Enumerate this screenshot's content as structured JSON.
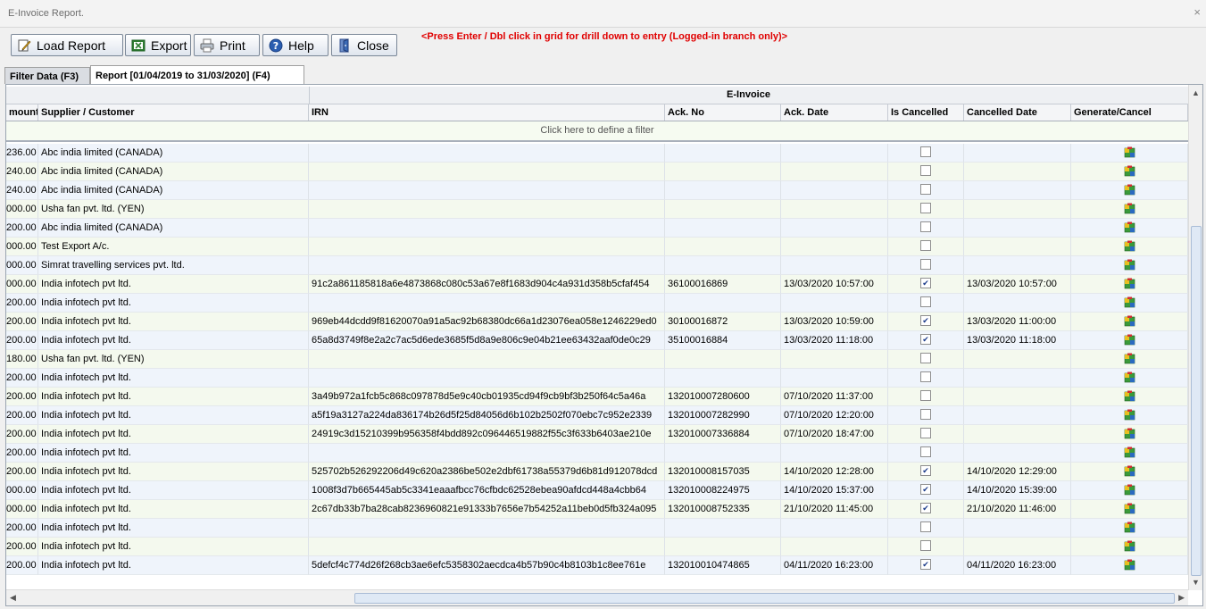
{
  "window": {
    "title": "E-Invoice Report.",
    "close_glyph": "×"
  },
  "toolbar": {
    "load_report": "Load Report",
    "export": "Export",
    "print": "Print",
    "help": "Help",
    "close": "Close",
    "notice": "<Press Enter / Dbl click in grid for drill down to entry (Logged-in branch only)>"
  },
  "tabs": [
    {
      "label": "Filter Data (F3)",
      "active": false
    },
    {
      "label": "Report [01/04/2019 to 31/03/2020] (F4)",
      "active": true
    }
  ],
  "grid": {
    "band_label": "E-Invoice",
    "columns": {
      "amount": "mount",
      "party": "Supplier / Customer",
      "irn": "IRN",
      "ack_no": "Ack. No",
      "ack_date": "Ack. Date",
      "is_cancelled": "Is Cancelled",
      "cancelled_date": "Cancelled Date",
      "generate_cancel": "Generate/Cancel"
    },
    "filter_prompt": "Click here to define a filter",
    "rows": [
      {
        "amount": "236.00",
        "party": "Abc india limited (CANADA)",
        "irn": "",
        "ack_no": "",
        "ack_date": "",
        "cancelled": false,
        "cancelled_date": ""
      },
      {
        "amount": "240.00",
        "party": "Abc india limited (CANADA)",
        "irn": "",
        "ack_no": "",
        "ack_date": "",
        "cancelled": false,
        "cancelled_date": ""
      },
      {
        "amount": "240.00",
        "party": "Abc india limited (CANADA)",
        "irn": "",
        "ack_no": "",
        "ack_date": "",
        "cancelled": false,
        "cancelled_date": ""
      },
      {
        "amount": "000.00",
        "party": "Usha fan pvt. ltd. (YEN)",
        "irn": "",
        "ack_no": "",
        "ack_date": "",
        "cancelled": false,
        "cancelled_date": ""
      },
      {
        "amount": "200.00",
        "party": "Abc india limited (CANADA)",
        "irn": "",
        "ack_no": "",
        "ack_date": "",
        "cancelled": false,
        "cancelled_date": ""
      },
      {
        "amount": "000.00",
        "party": "Test Export A/c.",
        "irn": "",
        "ack_no": "",
        "ack_date": "",
        "cancelled": false,
        "cancelled_date": ""
      },
      {
        "amount": "000.00",
        "party": "Simrat travelling services pvt. ltd.",
        "irn": "",
        "ack_no": "",
        "ack_date": "",
        "cancelled": false,
        "cancelled_date": ""
      },
      {
        "amount": "000.00",
        "party": "India infotech pvt ltd.",
        "irn": "91c2a861185818a6e4873868c080c53a67e8f1683d904c4a931d358b5cfaf454",
        "ack_no": "36100016869",
        "ack_date": "13/03/2020 10:57:00",
        "cancelled": true,
        "cancelled_date": "13/03/2020 10:57:00"
      },
      {
        "amount": "200.00",
        "party": "India infotech pvt ltd.",
        "irn": "",
        "ack_no": "",
        "ack_date": "",
        "cancelled": false,
        "cancelled_date": ""
      },
      {
        "amount": "200.00",
        "party": "India infotech pvt ltd.",
        "irn": "969eb44dcdd9f81620070a91a5ac92b68380dc66a1d23076ea058e1246229ed0",
        "ack_no": "30100016872",
        "ack_date": "13/03/2020 10:59:00",
        "cancelled": true,
        "cancelled_date": "13/03/2020 11:00:00"
      },
      {
        "amount": "200.00",
        "party": "India infotech pvt ltd.",
        "irn": "65a8d3749f8e2a2c7ac5d6ede3685f5d8a9e806c9e04b21ee63432aaf0de0c29",
        "ack_no": "35100016884",
        "ack_date": "13/03/2020 11:18:00",
        "cancelled": true,
        "cancelled_date": "13/03/2020 11:18:00"
      },
      {
        "amount": "180.00",
        "party": "Usha fan pvt. ltd. (YEN)",
        "irn": "",
        "ack_no": "",
        "ack_date": "",
        "cancelled": false,
        "cancelled_date": ""
      },
      {
        "amount": "200.00",
        "party": "India infotech pvt ltd.",
        "irn": "",
        "ack_no": "",
        "ack_date": "",
        "cancelled": false,
        "cancelled_date": ""
      },
      {
        "amount": "200.00",
        "party": "India infotech pvt ltd.",
        "irn": "3a49b972a1fcb5c868c097878d5e9c40cb01935cd94f9cb9bf3b250f64c5a46a",
        "ack_no": "132010007280600",
        "ack_date": "07/10/2020 11:37:00",
        "cancelled": false,
        "cancelled_date": ""
      },
      {
        "amount": "200.00",
        "party": "India infotech pvt ltd.",
        "irn": "a5f19a3127a224da836174b26d5f25d84056d6b102b2502f070ebc7c952e2339",
        "ack_no": "132010007282990",
        "ack_date": "07/10/2020 12:20:00",
        "cancelled": false,
        "cancelled_date": ""
      },
      {
        "amount": "200.00",
        "party": "India infotech pvt ltd.",
        "irn": "24919c3d15210399b956358f4bdd892c096446519882f55c3f633b6403ae210e",
        "ack_no": "132010007336884",
        "ack_date": "07/10/2020 18:47:00",
        "cancelled": false,
        "cancelled_date": ""
      },
      {
        "amount": "200.00",
        "party": "India infotech pvt ltd.",
        "irn": "",
        "ack_no": "",
        "ack_date": "",
        "cancelled": false,
        "cancelled_date": ""
      },
      {
        "amount": "200.00",
        "party": "India infotech pvt ltd.",
        "irn": "525702b526292206d49c620a2386be502e2dbf61738a55379d6b81d912078dcd",
        "ack_no": "132010008157035",
        "ack_date": "14/10/2020 12:28:00",
        "cancelled": true,
        "cancelled_date": "14/10/2020 12:29:00"
      },
      {
        "amount": "000.00",
        "party": "India infotech pvt ltd.",
        "irn": "1008f3d7b665445ab5c3341eaaafbcc76cfbdc62528ebea90afdcd448a4cbb64",
        "ack_no": "132010008224975",
        "ack_date": "14/10/2020 15:37:00",
        "cancelled": true,
        "cancelled_date": "14/10/2020 15:39:00"
      },
      {
        "amount": "000.00",
        "party": "India infotech pvt ltd.",
        "irn": "2c67db33b7ba28cab8236960821e91333b7656e7b54252a11beb0d5fb324a095",
        "ack_no": "132010008752335",
        "ack_date": "21/10/2020 11:45:00",
        "cancelled": true,
        "cancelled_date": "21/10/2020 11:46:00"
      },
      {
        "amount": "200.00",
        "party": "India infotech pvt ltd.",
        "irn": "",
        "ack_no": "",
        "ack_date": "",
        "cancelled": false,
        "cancelled_date": ""
      },
      {
        "amount": "200.00",
        "party": "India infotech pvt ltd.",
        "irn": "",
        "ack_no": "",
        "ack_date": "",
        "cancelled": false,
        "cancelled_date": ""
      },
      {
        "amount": "200.00",
        "party": "India infotech pvt ltd.",
        "irn": "5defcf4c774d26f268cb3ae6efc5358302aecdca4b57b90c4b8103b1c8ee761e",
        "ack_no": "132010010474865",
        "ack_date": "04/11/2020 16:23:00",
        "cancelled": true,
        "cancelled_date": "04/11/2020 16:23:00"
      }
    ]
  },
  "icons": {
    "load_report": "pencil-document-icon",
    "export": "excel-icon",
    "print": "printer-icon",
    "help": "help-icon",
    "close": "exit-door-icon",
    "generate_cancel": "generate-cancel-icon"
  },
  "colors": {
    "notice": "#e00000",
    "row_odd": "#eff4fb",
    "row_even": "#f4f9ee"
  }
}
